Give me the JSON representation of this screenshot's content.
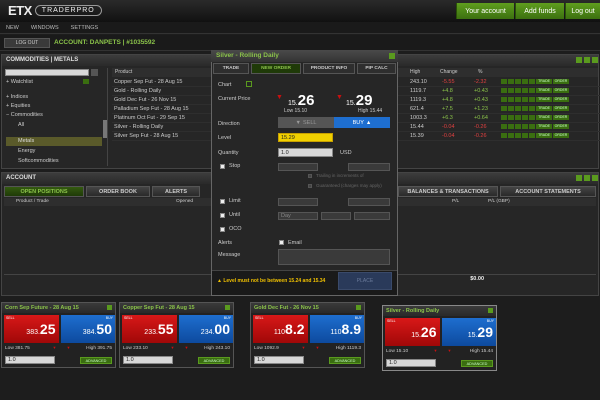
{
  "header": {
    "logo_main": "ETX",
    "logo_sub": "TRADERPRO",
    "your_account": "Your account",
    "add_funds": "Add funds",
    "logout": "Log out"
  },
  "menu": [
    "NEW",
    "WINDOWS",
    "SETTINGS"
  ],
  "account_bar": {
    "logout": "LOG OUT",
    "account": "ACCOUNT: DANPETS | #1035592"
  },
  "markets": {
    "title": "COMMODITIES | METALS",
    "list": [
      "Watchlist",
      "Indices",
      "Equities",
      "Commodities",
      "All",
      "Metals",
      "Energy",
      "Softcommodities"
    ],
    "columns": [
      "Product",
      "High",
      "Change",
      "%"
    ],
    "rows": [
      {
        "product": "Copper Sep Fut - 28 Aug 15",
        "high": "243.10",
        "change": "-5.55",
        "pct": "-2.32"
      },
      {
        "product": "Gold - Rolling Daily",
        "high": "1119.7",
        "change": "+4.8",
        "pct": "+0.43"
      },
      {
        "product": "Gold Dec Fut - 26 Nov 15",
        "high": "1119.3",
        "change": "+4.8",
        "pct": "+0.43"
      },
      {
        "product": "Palladium Sep Fut - 28 Aug 15",
        "high": "621.4",
        "change": "+7.5",
        "pct": "+1.23"
      },
      {
        "product": "Platinum Oct Fut - 29 Sep 15",
        "high": "1003.3",
        "change": "+6.3",
        "pct": "+0.64"
      },
      {
        "product": "Silver - Rolling Daily",
        "high": "15.44",
        "change": "-0.04",
        "pct": "-0.26"
      },
      {
        "product": "Silver Sep Fut - 28 Aug 15",
        "high": "15.39",
        "change": "-0.04",
        "pct": "-0.26"
      }
    ],
    "trade_label": "TRADE",
    "order_label": "ORDER"
  },
  "account": {
    "title": "ACCOUNT",
    "tabs": [
      "OPEN POSITIONS",
      "ORDER BOOK",
      "ALERTS",
      "BALANCES & TRANSACTIONS",
      "ACCOUNT STATEMENTS"
    ],
    "columns": [
      "Product / Trade",
      "Opened",
      "P/L",
      "P/L (GBP)"
    ],
    "total": "$0.00"
  },
  "modal": {
    "title": "Silver - Rolling Daily",
    "tabs": [
      "TRADE",
      "NEW ORDER",
      "PRODUCT INFO",
      "PIP CALC"
    ],
    "chart": "Chart",
    "current_price": "Current Price",
    "sell_small": "15.",
    "sell_big": "26",
    "buy_small": "15.",
    "buy_big": "29",
    "low": "Low 15.10",
    "high": "High 15.44",
    "direction": "Direction",
    "sell_btn": "SELL",
    "buy_btn": "BUY",
    "level": "Level",
    "level_value": "15.29",
    "quantity": "Quantity",
    "quantity_value": "1.0",
    "unit": "USD",
    "stop": "Stop",
    "limit": "Limit",
    "until": "Until",
    "oco": "OCO",
    "until_value": "Day",
    "trailing": "Trailing in increments of",
    "guaranteed": "Guaranteed (charges may apply)",
    "alerts": "Alerts",
    "email": "Email",
    "message": "Message",
    "warning": "Level must not be between 15.24 and 15.34",
    "place_label": "PLACE"
  },
  "tickets": [
    {
      "title": "Corn Sep Future - 28 Aug 15",
      "sell_small": "383.",
      "sell_big": "25",
      "buy_small": "384.",
      "buy_big": "50",
      "low": "Low 381.75",
      "high": "High 391.75",
      "qty": "1.0"
    },
    {
      "title": "Copper Sep Fut - 28 Aug 15",
      "sell_small": "233.",
      "sell_big": "55",
      "buy_small": "234.",
      "buy_big": "00",
      "low": "Low 233.10",
      "high": "High 243.10",
      "qty": "1.0"
    },
    {
      "title": "Gold Dec Fut - 26 Nov 15",
      "sell_small": "110",
      "sell_big": "8.2",
      "buy_small": "110",
      "buy_big": "8.9",
      "low": "Low 1092.9",
      "high": "High 1119.3",
      "qty": "1.0"
    },
    {
      "title": "Silver - Rolling Daily",
      "sell_small": "15.",
      "sell_big": "26",
      "buy_small": "15.",
      "buy_big": "29",
      "low": "Low 15.10",
      "high": "High 15.44",
      "qty": "1.0"
    }
  ],
  "ticket_labels": {
    "sell": "SELL",
    "buy": "BUY",
    "advanced": "ADVANCED"
  },
  "colors": {
    "accent": "#5a9a1e",
    "sell": "#c81010",
    "buy": "#1e6ecf"
  }
}
